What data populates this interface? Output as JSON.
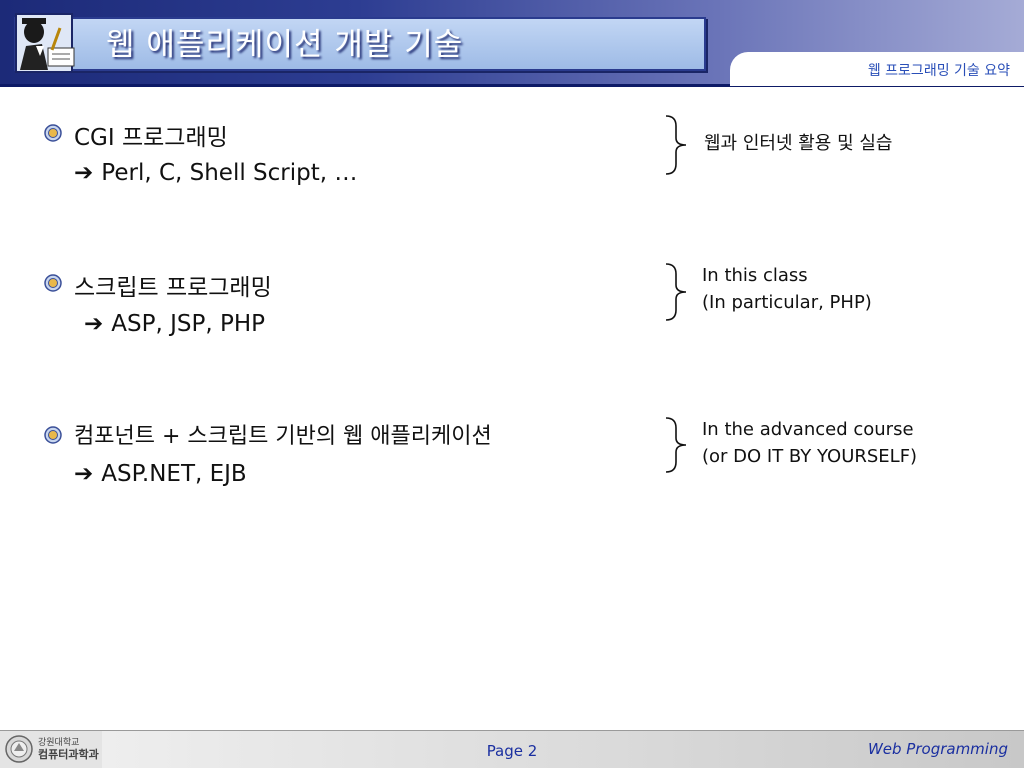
{
  "header": {
    "title": "웹 애플리케이션 개발 기술",
    "subtitle": "웹 프로그래밍 기술 요약"
  },
  "items": [
    {
      "main": "CGI 프로그래밍",
      "sub": "Perl, C, Shell Script, …"
    },
    {
      "main": "스크립트 프로그래밍",
      "sub": "ASP, JSP, PHP"
    },
    {
      "main": "컴포넌트 + 스크립트 기반의 웹 애플리케이션",
      "sub": "ASP.NET, EJB"
    }
  ],
  "arrow_glyph": "➔",
  "notes": [
    {
      "lines": [
        "웹과 인터넷 활용 및 실습"
      ]
    },
    {
      "lines": [
        "In this class",
        "(In particular, PHP)"
      ]
    },
    {
      "lines": [
        "In the advanced course",
        "(or DO IT BY YOURSELF)"
      ]
    }
  ],
  "footer": {
    "logo_text_line1": "강원대학교",
    "logo_text_line2": "컴퓨터과학과",
    "page": "Page 2",
    "course": "Web Programming"
  },
  "colors": {
    "header_dark": "#1c2a78",
    "title_box": "#a9c3ec",
    "accent_blue": "#1a2fa0"
  }
}
